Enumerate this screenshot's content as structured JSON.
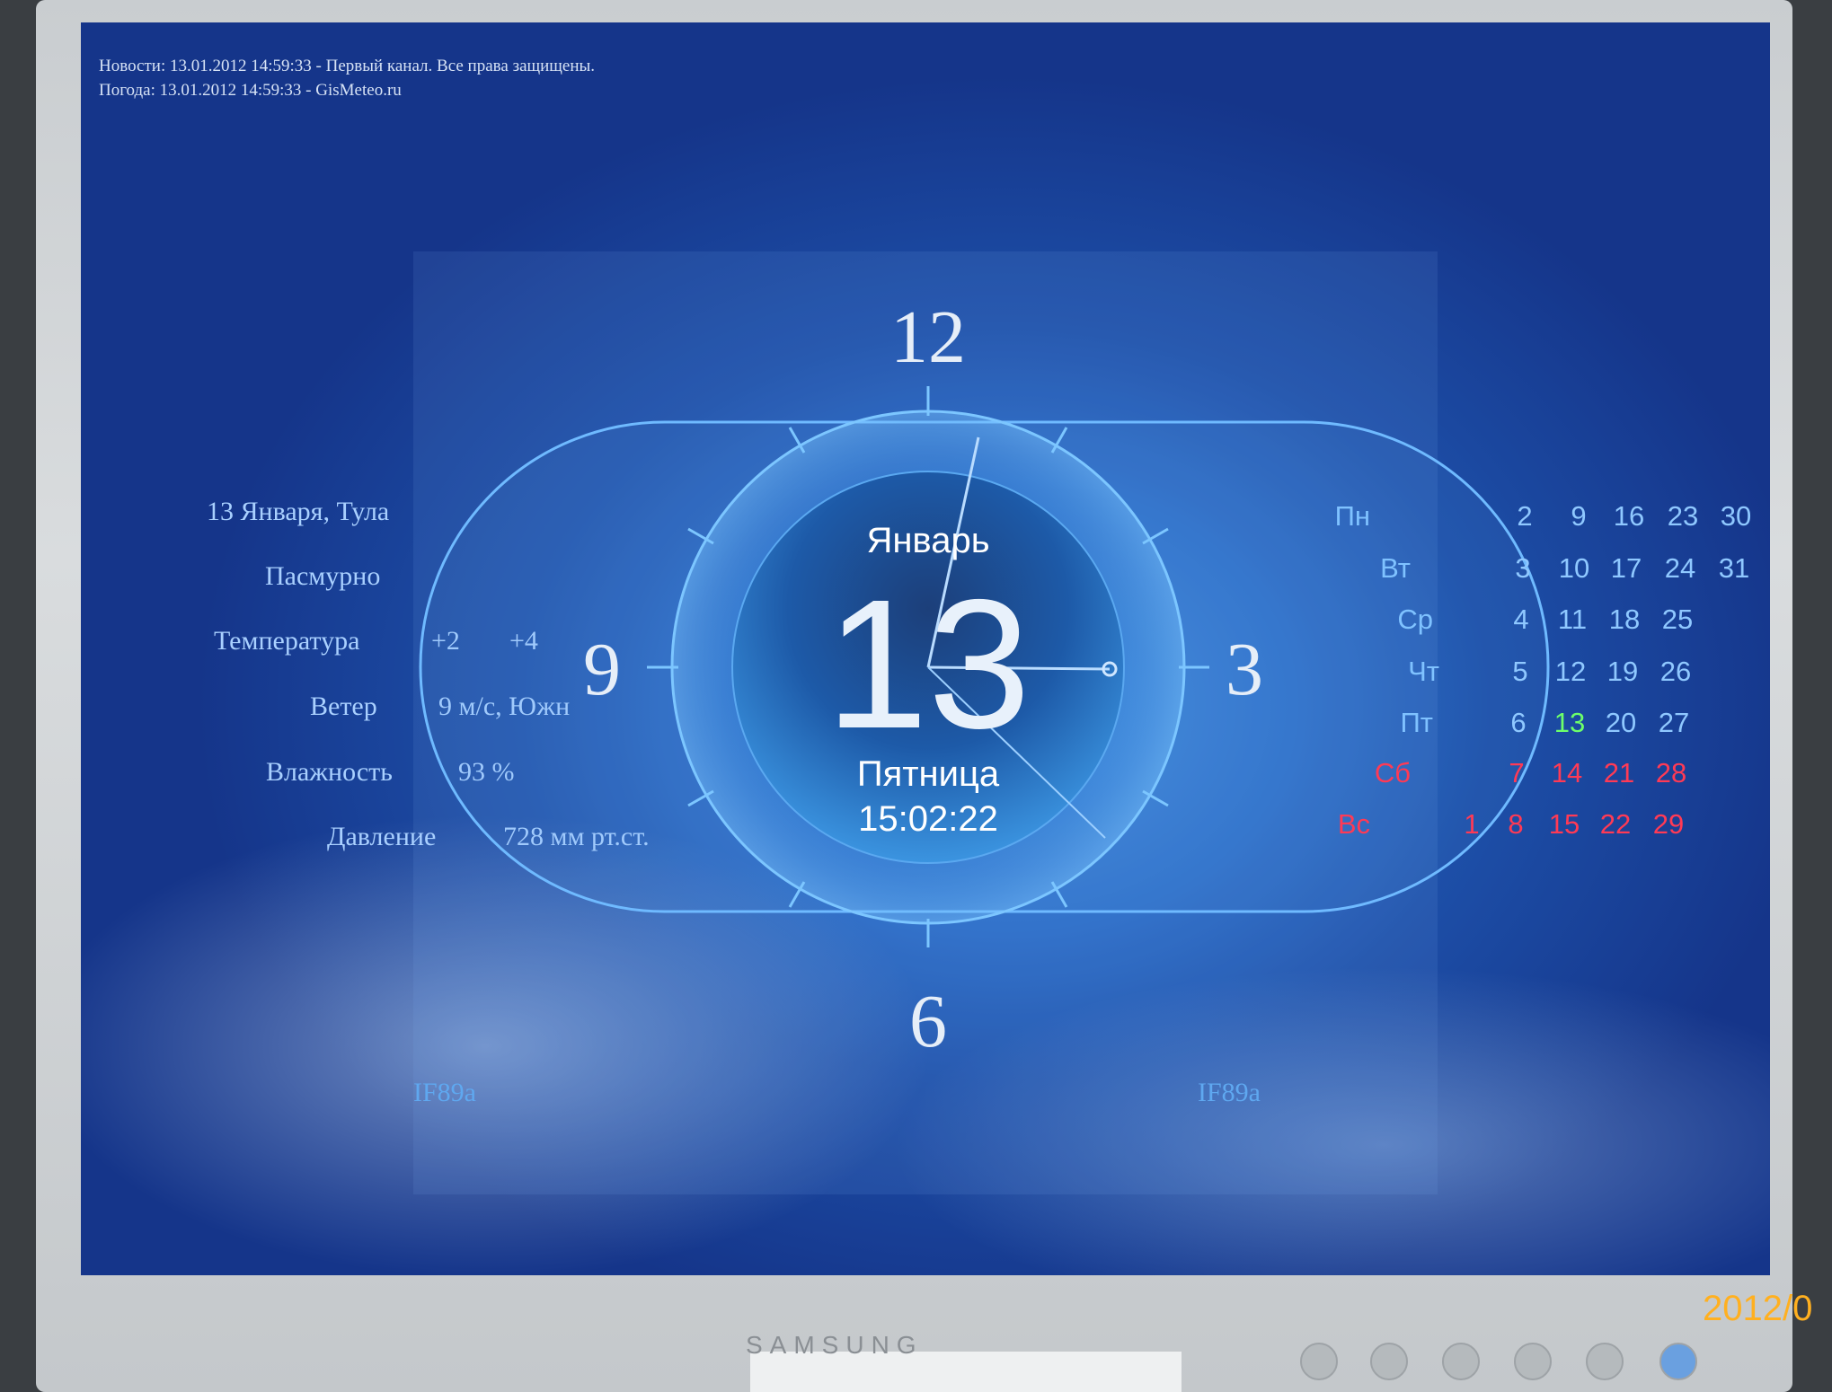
{
  "ticker": {
    "news": "Новости: 13.01.2012 14:59:33 - Первый канал. Все права защищены.",
    "weather": "Погода: 13.01.2012 14:59:33 - GisMeteo.ru"
  },
  "weather": {
    "location": "13 Января, Тула",
    "condition": "Пасмурно",
    "temperature_label": "Температура",
    "temperature_min": "+2",
    "temperature_max": "+4",
    "wind_label": "Ветер",
    "wind_value": "9  м/с, Южн",
    "humidity_label": "Влажность",
    "humidity_value": "93 %",
    "pressure_label": "Давление",
    "pressure_value": "728  мм рт.ст."
  },
  "clock": {
    "numerals": {
      "twelve": "12",
      "three": "3",
      "six": "6",
      "nine": "9"
    },
    "month": "Январь",
    "day": "13",
    "weekday": "Пятница",
    "time": "15:02:22"
  },
  "calendar": {
    "weekdays": [
      "Пн",
      "Вт",
      "Ср",
      "Чт",
      "Пт",
      "Сб",
      "Вс"
    ],
    "rows": [
      [
        "",
        "2",
        "9",
        "16",
        "23",
        "30"
      ],
      [
        "",
        "3",
        "10",
        "17",
        "24",
        "31"
      ],
      [
        "",
        "4",
        "11",
        "18",
        "25",
        ""
      ],
      [
        "",
        "5",
        "12",
        "19",
        "26",
        ""
      ],
      [
        "",
        "6",
        "13",
        "20",
        "27",
        ""
      ],
      [
        "",
        "7",
        "14",
        "21",
        "28",
        ""
      ],
      [
        "1",
        "8",
        "15",
        "22",
        "29",
        ""
      ]
    ],
    "today": "13"
  },
  "watermark": {
    "left": "IF89a",
    "right": "IF89a"
  },
  "monitor": {
    "brand": "SAMSUNG"
  },
  "photo_stamp": "2012/0",
  "colors": {
    "weekend": "#ff3a55",
    "today": "#6dff6a",
    "weekday": "#7fc2ff"
  }
}
